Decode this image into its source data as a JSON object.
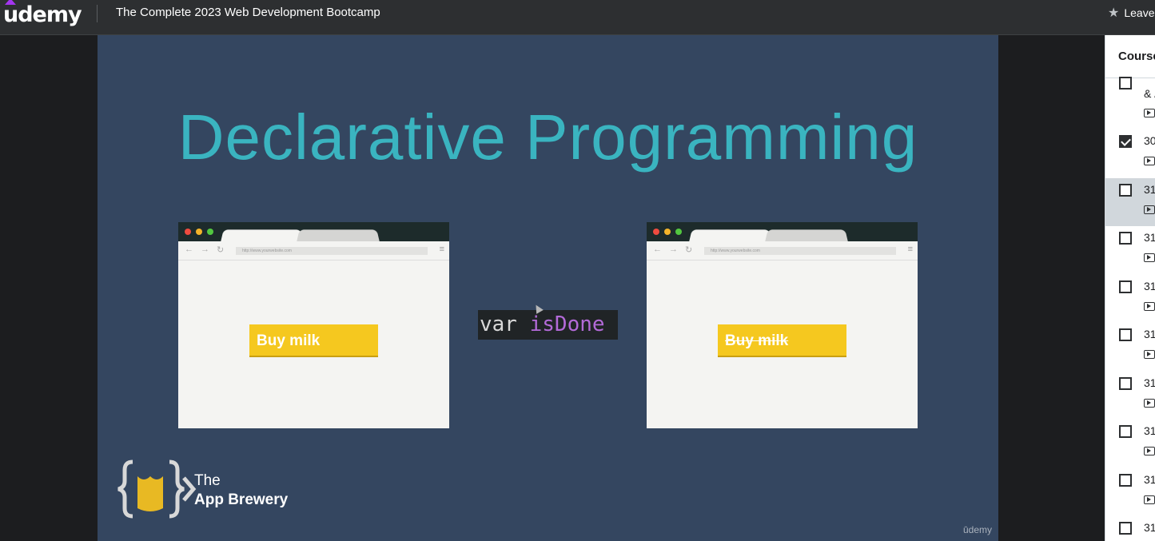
{
  "header": {
    "logo": "udemy",
    "course_title": "The Complete 2023 Web Development Bootcamp",
    "rating_label": "Leave"
  },
  "slide": {
    "title": "Declarative Programming",
    "left_button": "Buy milk",
    "right_button": "Buy milk",
    "code_keyword": "var",
    "code_variable": "isDone",
    "url_text": "http://www.yourwebsite.com",
    "brand_the": "The",
    "brand_name": "App Brewery",
    "watermark": "ūdemy"
  },
  "sidebar": {
    "title": "Course content",
    "top_partial": "& /",
    "items": [
      {
        "num": "30",
        "checked": true
      },
      {
        "num": "31",
        "checked": false,
        "active": true
      },
      {
        "num": "31",
        "checked": false
      },
      {
        "num": "31",
        "checked": false
      },
      {
        "num": "31",
        "checked": false
      },
      {
        "num": "31",
        "checked": false
      },
      {
        "num": "31",
        "checked": false
      },
      {
        "num": "31",
        "checked": false
      },
      {
        "num": "31",
        "checked": false
      }
    ]
  },
  "colors": {
    "slide_bg": "#344660",
    "title_teal": "#3ab4c0",
    "button_yellow": "#f5c81f",
    "code_purple": "#b36ad8",
    "brand_purple": "#a435f0"
  }
}
